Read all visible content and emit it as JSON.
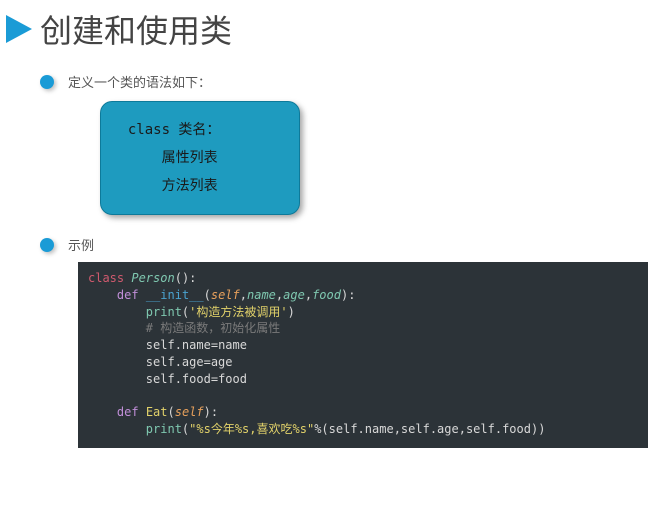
{
  "title": "创建和使用类",
  "bullets": {
    "syntax_intro": "定义一个类的语法如下：",
    "example_label": "示例"
  },
  "syntax_box": {
    "line1": "  class 类名：",
    "line2": "      属性列表",
    "line3": "      方法列表"
  },
  "code": {
    "kw_class": "class",
    "cls_name": "Person",
    "paren_colon": "():",
    "kw_def1": "def",
    "fn_init": "__init__",
    "open_paren": "(",
    "self": "self",
    "comma": ",",
    "p_name": "name",
    "p_age": "age",
    "p_food": "food",
    "close_pc": "):",
    "print": "print",
    "str_ctor": "'构造方法被调用'",
    "close_paren": ")",
    "comment": "# 构造函数，初始化属性",
    "assign_name": "self.name",
    "eq": "=",
    "rhs_name": "name",
    "assign_age": "self.age",
    "rhs_age": "age",
    "assign_food": "self.food",
    "rhs_food": "food",
    "kw_def2": "def",
    "fn_eat": "Eat",
    "eat_args_open": "(",
    "eat_self": "self",
    "eat_args_close": "):",
    "str_fmt": "\"%s今年%s,喜欢吃%s\"",
    "pct": "%",
    "tuple_open": "(",
    "t_name": "self.name",
    "t_age": "self.age",
    "t_food": "self.food",
    "tuple_close": "))"
  }
}
